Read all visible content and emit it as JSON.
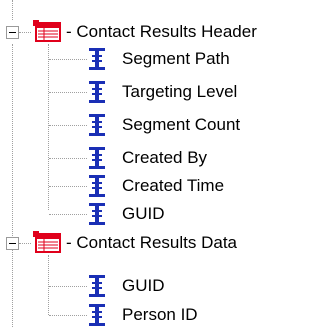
{
  "tree": {
    "groups": [
      {
        "label": "- Contact Results Header",
        "icon": "table-icon",
        "expanded": true,
        "fields": [
          {
            "label": "Segment Path",
            "icon": "field-icon"
          },
          {
            "label": "Targeting Level",
            "icon": "field-icon"
          },
          {
            "label": "Segment Count",
            "icon": "field-icon"
          },
          {
            "label": "Created By",
            "icon": "field-icon"
          },
          {
            "label": "Created Time",
            "icon": "field-icon"
          },
          {
            "label": "GUID",
            "icon": "field-icon"
          }
        ]
      },
      {
        "label": "- Contact Results Data",
        "icon": "table-icon",
        "expanded": true,
        "fields": [
          {
            "label": "GUID",
            "icon": "field-icon"
          },
          {
            "label": "Person ID",
            "icon": "field-icon"
          }
        ]
      }
    ]
  },
  "colors": {
    "table_icon_red": "#e0001b",
    "field_icon_blue": "#1a2fb5",
    "tree_line": "#a0a0a0"
  }
}
